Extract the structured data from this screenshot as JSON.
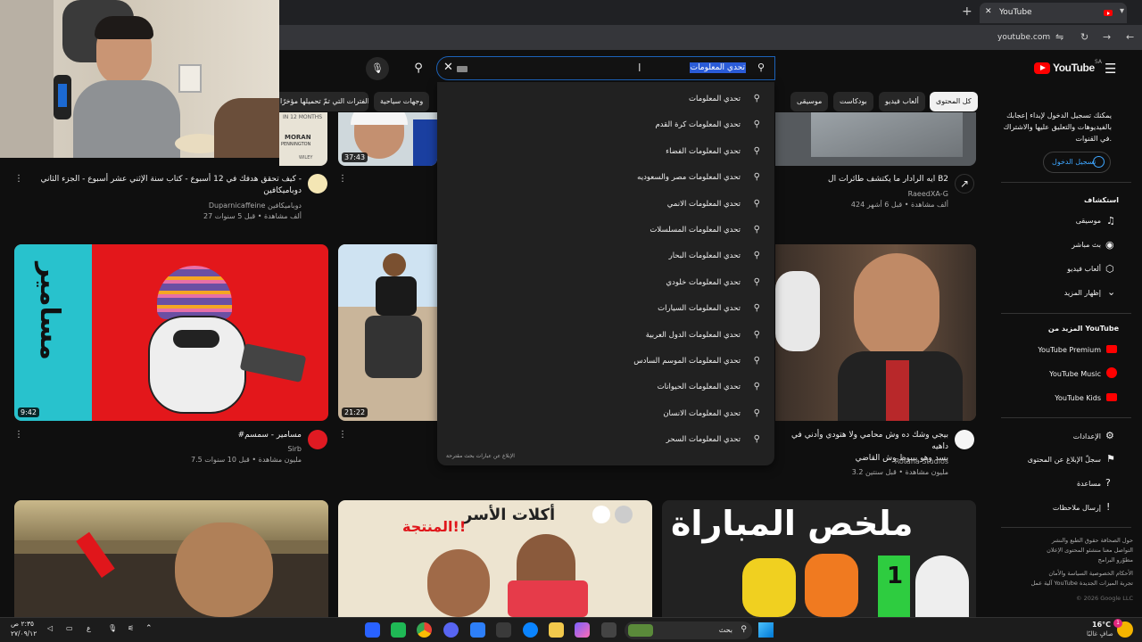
{
  "browser": {
    "tab_title": "YouTube",
    "tab_close": "✕",
    "new_tab": "+",
    "url": "youtube.com"
  },
  "header": {
    "logo_text": "YouTube",
    "region": "SA",
    "search_query": "تحدي المعلومات"
  },
  "chips": [
    "كل المحتوى",
    "ألعاب فيديو",
    "بودكاست",
    "موسيقى",
    "وجهات سياحية",
    "الفترات التي تمّ تحميلها مؤخرًا"
  ],
  "suggestions": [
    "تحدي المعلومات",
    "تحدي المعلومات كرة القدم",
    "تحدي المعلومات الفضاء",
    "تحدي المعلومات مصر والسعوديه",
    "تحدي المعلومات الانمي",
    "تحدي المعلومات المسلسلات",
    "تحدي المعلومات البحار",
    "تحدي المعلومات خلودي",
    "تحدي المعلومات السيارات",
    "تحدي المعلومات الدول العربية",
    "تحدي المعلومات الموسم السادس",
    "تحدي المعلومات الحيوانات",
    "تحدي المعلومات الانسان",
    "تحدي المعلومات السحر"
  ],
  "report_text": "الإبلاغ عن عبارات بحث مقترحة",
  "videos": [
    {
      "title_l1": "كيف تحقق هدفك في 12 أسبوع - كتاب سنة الإثني عشر أسبوع - الجزء الثاني -",
      "title_l2": "دوباميكافين",
      "channel": "Duparnicaffeine دوباميكافين",
      "meta": "27 ألف مشاهدة • قبل 5 سنوات"
    },
    {
      "title_l1": "ايه الرادار ما يكتشف طائرات ال B2",
      "title_l2": "",
      "channel": "RaeedXA-G",
      "meta": "424 ألف مشاهدة • قبل 6 أشهر"
    },
    {
      "title_l1": "#مسامير - سمسم",
      "title_l2": "",
      "channel": "Sirb",
      "meta": "7.5 مليون مشاهدة • قبل 10 سنوات",
      "duration": "9:42"
    },
    {
      "title_l1": "بيجي وشك ده وش محامي ولا هتودي وأدني في داهيه",
      "title_l2": "بسد وهو بيبوظ وش القاضي",
      "channel": "Rotana Studios",
      "meta": "3.2 مليون مشاهدة • قبل سنتين"
    }
  ],
  "durations": {
    "v1": "37:43",
    "v2": "21:22"
  },
  "thumb_text": {
    "moran": "MORAN",
    "moran2": "PENNINGTON",
    "wiley": "WILEY",
    "months": "IN 12 MONTHS",
    "mls": "ملخص المباراة",
    "aklat": "أكلات الأسر",
    "montaj": "المنتجة!!",
    "score": "1"
  },
  "sidebar": {
    "signin_text_l1": "يمكنك تسجيل الدخول لإبداء إعجابك",
    "signin_text_l2": "بالفيديوهات والتعليق عليها والاشتراك",
    "signin_text_l3": "في القنوات.",
    "signin_button": "تسجيل الدخول",
    "explore": "استكشاف",
    "explore_items": [
      "موسيقى",
      "بث مباشر",
      "ألعاب فيديو",
      "إظهار المزيد"
    ],
    "more_title": "المزيد من YouTube",
    "more_items": [
      "YouTube Premium",
      "YouTube Music",
      "YouTube Kids"
    ],
    "settings_items": [
      "الإعدادات",
      "سجلّ الإبلاغ عن المحتوى",
      "مساعدة",
      "إرسال ملاحظات"
    ],
    "footer_l1": "حول  الصحافة  حقوق الطبع والنشر",
    "footer_l2": "التواصل معنا  منشئو المحتوى  الإعلان",
    "footer_l3": "مطوّرو البرامج",
    "footer_l4": "الأحكام  الخصوصية  السياسة والأمان",
    "footer_l5": "آلية عمل YouTube  تجربة الميزات الجديدة",
    "copyright": "© 2026 Google LLC"
  },
  "taskbar": {
    "weather_temp": "16°C",
    "weather_desc": "صافٍ غالبًا",
    "search": "بحث",
    "time": "٢:٣٥ ص",
    "date": "٢٧/٠٩/١٢",
    "lang": "ع",
    "badge": "1"
  }
}
